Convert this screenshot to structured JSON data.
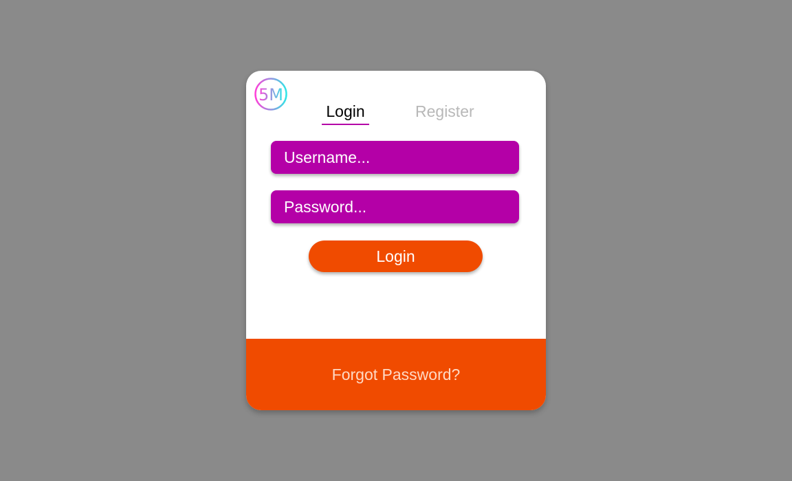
{
  "logo": {
    "text": "5M",
    "gradient_start": "#ff3fd8",
    "gradient_end": "#2ee6e6"
  },
  "tabs": [
    {
      "label": "Login",
      "active": true
    },
    {
      "label": "Register",
      "active": false
    }
  ],
  "form": {
    "username_placeholder": "Username...",
    "password_placeholder": "Password...",
    "submit_label": "Login"
  },
  "footer": {
    "forgot_label": "Forgot Password?"
  },
  "colors": {
    "background": "#8a8a8a",
    "card": "#ffffff",
    "accent_purple": "#b400a7",
    "accent_orange": "#f04b00",
    "inactive_tab": "#b8b8b8"
  }
}
